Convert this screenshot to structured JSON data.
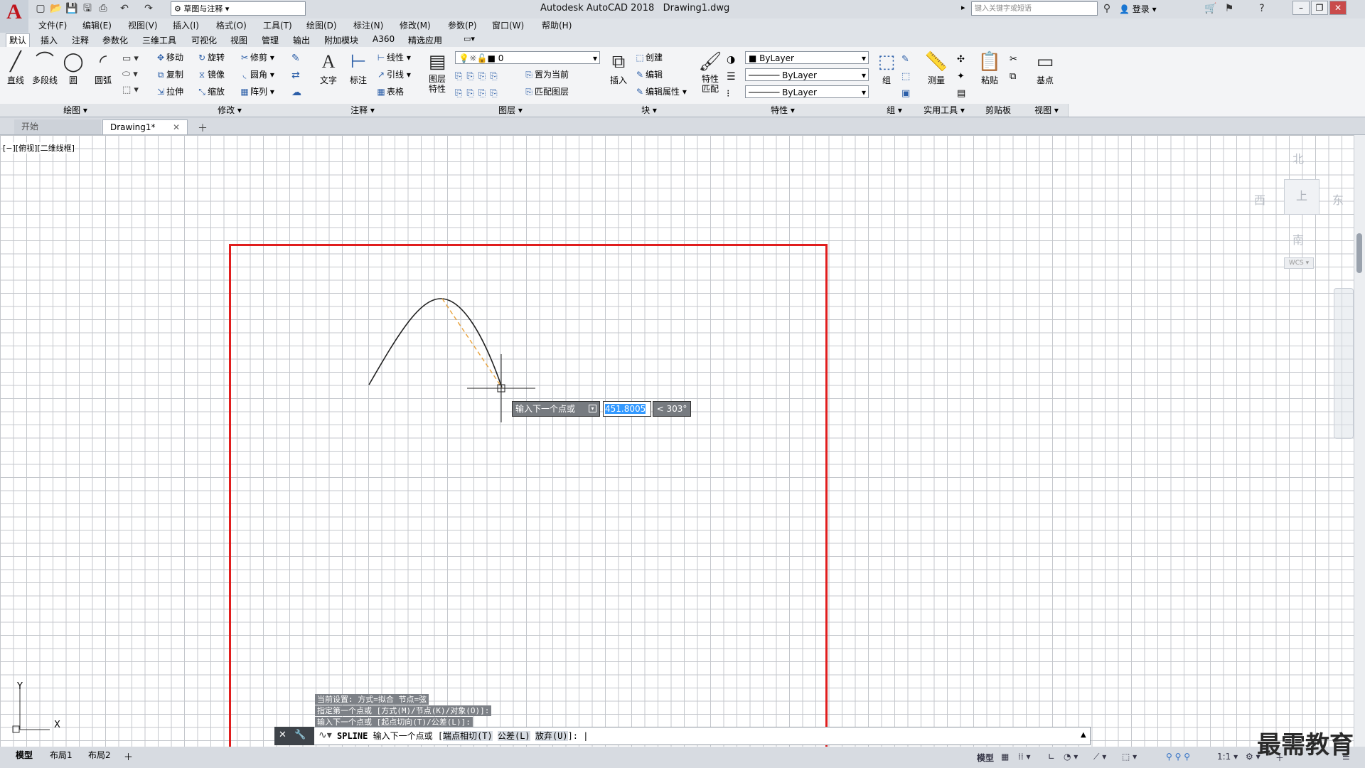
{
  "app": {
    "title": "Autodesk AutoCAD 2018",
    "document": "Drawing1.dwg",
    "logo": "A",
    "workspace": "草图与注释",
    "search_placeholder": "键入关键字或短语",
    "login": "登录"
  },
  "menus": [
    "文件(F)",
    "编辑(E)",
    "视图(V)",
    "插入(I)",
    "格式(O)",
    "工具(T)",
    "绘图(D)",
    "标注(N)",
    "修改(M)",
    "参数(P)",
    "窗口(W)",
    "帮助(H)"
  ],
  "ribbon_tabs": [
    "默认",
    "插入",
    "注释",
    "参数化",
    "三维工具",
    "可视化",
    "视图",
    "管理",
    "输出",
    "附加模块",
    "A360",
    "精选应用"
  ],
  "ribbon": {
    "draw": {
      "title": "绘图",
      "buttons": [
        "直线",
        "多段线",
        "圆",
        "圆弧"
      ]
    },
    "modify": {
      "title": "修改",
      "buttons": [
        "移动",
        "旋转",
        "修剪",
        "复制",
        "镜像",
        "圆角",
        "拉伸",
        "缩放",
        "阵列"
      ]
    },
    "annotation": {
      "title": "注释",
      "buttons": [
        "文字",
        "标注",
        "线性",
        "引线",
        "表格"
      ]
    },
    "layers": {
      "title": "图层",
      "layer_props": "图层\n特性",
      "current_layer": "0",
      "buttons": [
        "置为当前",
        "匹配图层"
      ]
    },
    "block": {
      "title": "块",
      "buttons": [
        "插入",
        "创建",
        "编辑",
        "编辑属性"
      ]
    },
    "properties": {
      "title": "特性",
      "match": "特性\n匹配",
      "color": "ByLayer",
      "linetype": "ByLayer",
      "lineweight": "ByLayer"
    },
    "groups": {
      "title": "组",
      "label": "组"
    },
    "utilities": {
      "title": "实用工具",
      "label": "测量"
    },
    "clipboard": {
      "title": "剪贴板",
      "label": "粘贴"
    },
    "view": {
      "title": "视图",
      "label": "基点"
    }
  },
  "file_tabs": [
    {
      "label": "开始"
    },
    {
      "label": "Drawing1*"
    }
  ],
  "viewport_label": "[−][俯视][二维线框]",
  "viewcube": {
    "north": "北",
    "south": "南",
    "east": "东",
    "west": "西",
    "top": "上",
    "wcs": "WCS"
  },
  "ucs": {
    "x": "X",
    "y": "Y"
  },
  "dynamic_input": {
    "prompt": "输入下一个点或",
    "value": "451.8005",
    "angle": "< 303°"
  },
  "command_history": [
    "当前设置: 方式=拟合    节点=弦",
    "指定第一个点或 [方式(M)/节点(K)/对象(O)]:",
    "输入下一个点或 [起点切向(T)/公差(L)]:"
  ],
  "command_line": {
    "command": "SPLINE",
    "prompt": "输入下一个点或 [",
    "opt1": "端点相切(T)",
    "opt2": "公差(L)",
    "opt3": "放弃(U)",
    "tail": "]:"
  },
  "layout_tabs": [
    "模型",
    "布局1",
    "布局2"
  ],
  "status": {
    "model": "模型",
    "scale": "1:1"
  },
  "watermark": "最需教育"
}
